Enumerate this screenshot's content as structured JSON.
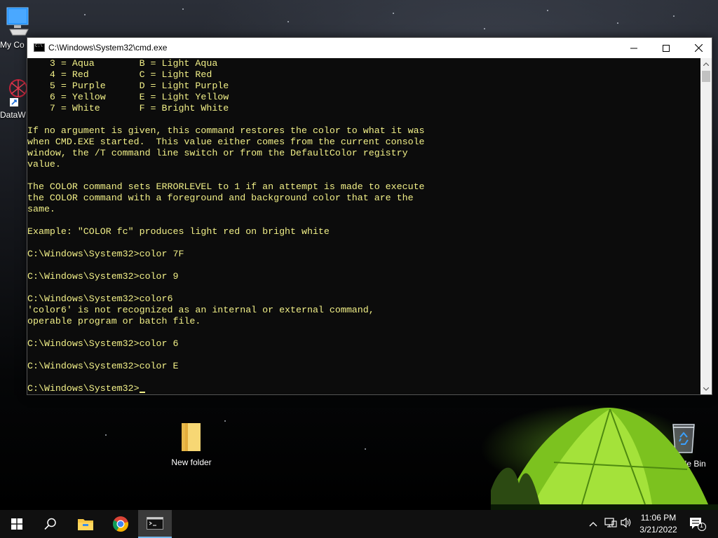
{
  "desktop": {
    "icons": {
      "my_computer": "My Co",
      "datawrapper": "DataW",
      "new_folder": "New folder",
      "recycle_bin": "Recycle Bin"
    }
  },
  "window": {
    "title": "C:\\Windows\\System32\\cmd.exe",
    "controls": {
      "minimize": "minimize-icon",
      "maximize": "maximize-icon",
      "close": "close-icon"
    },
    "console_color": "#f2f088",
    "console_bg": "#0c0c0c"
  },
  "console": {
    "lines": [
      "    3 = Aqua        B = Light Aqua",
      "    4 = Red         C = Light Red",
      "    5 = Purple      D = Light Purple",
      "    6 = Yellow      E = Light Yellow",
      "    7 = White       F = Bright White",
      "",
      "If no argument is given, this command restores the color to what it was",
      "when CMD.EXE started.  This value either comes from the current console",
      "window, the /T command line switch or from the DefaultColor registry",
      "value.",
      "",
      "The COLOR command sets ERRORLEVEL to 1 if an attempt is made to execute",
      "the COLOR command with a foreground and background color that are the",
      "same.",
      "",
      "Example: \"COLOR fc\" produces light red on bright white",
      "",
      "C:\\Windows\\System32>color 7F",
      "",
      "C:\\Windows\\System32>color 9",
      "",
      "C:\\Windows\\System32>color6",
      "'color6' is not recognized as an internal or external command,",
      "operable program or batch file.",
      "",
      "C:\\Windows\\System32>color 6",
      "",
      "C:\\Windows\\System32>color E",
      ""
    ],
    "prompt": "C:\\Windows\\System32>"
  },
  "taskbar": {
    "items": [
      "windows-start-icon",
      "search-icon",
      "file-explorer-icon",
      "chrome-icon",
      "cmd-icon"
    ],
    "clock": {
      "time": "11:06 PM",
      "date": "3/21/2022"
    },
    "notification_count": "1"
  }
}
